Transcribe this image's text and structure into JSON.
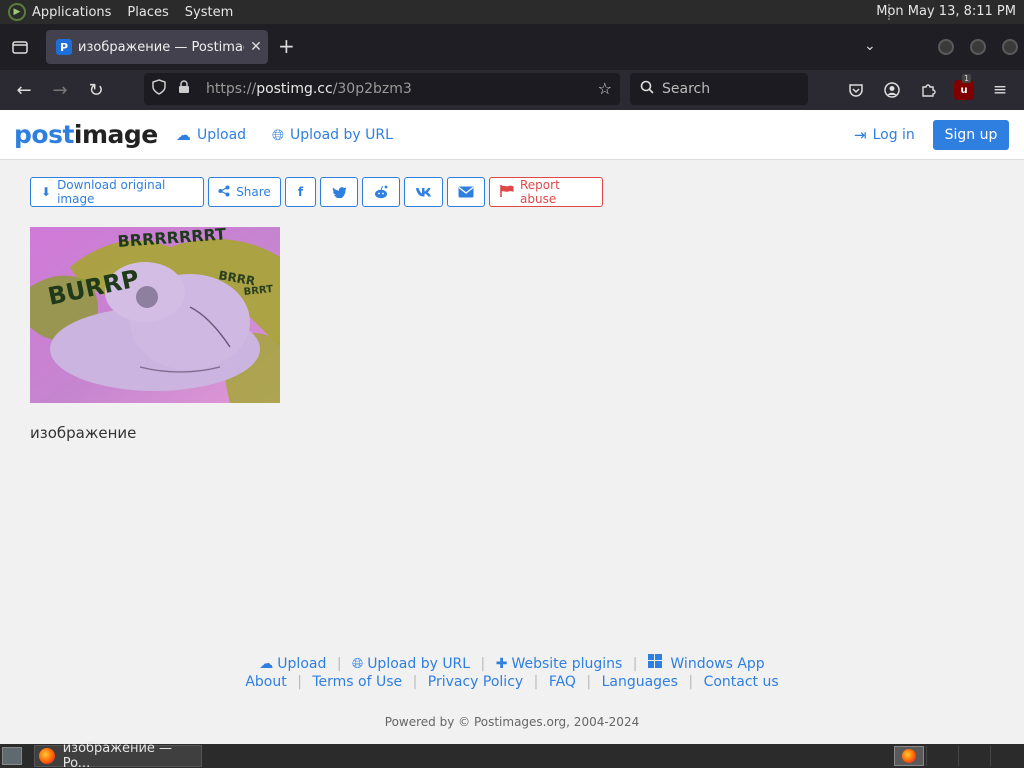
{
  "system_panel": {
    "menus": [
      "Applications",
      "Places",
      "System"
    ],
    "clock": "Mon May 13,  8:11 PM"
  },
  "browser": {
    "tab": {
      "favicon": "P",
      "title": "изображение — Postimage"
    },
    "url": {
      "scheme": "https://",
      "host": "postimg.cc",
      "path": "/30p2bzm3"
    },
    "search_placeholder": "Search",
    "ublock_count": "1"
  },
  "site": {
    "brand_part1": "post",
    "brand_part2": "image",
    "nav": {
      "upload": "Upload",
      "upload_by_url": "Upload by URL",
      "login": "Log in",
      "signup": "Sign up"
    },
    "actions": {
      "download": "Download original image",
      "share": "Share",
      "facebook": "f",
      "twitter": "t",
      "reddit": "r",
      "vk": "vk",
      "email": "mail",
      "report": "Report abuse"
    },
    "image": {
      "caption": "изображение",
      "lettering": [
        "BRRRRRRRT",
        "BURRP",
        "BRRR",
        "BRRT"
      ]
    },
    "footer": {
      "row1": [
        "Upload",
        "Upload by URL",
        "Website plugins",
        "Windows App"
      ],
      "row2": [
        "About",
        "Terms of Use",
        "Privacy Policy",
        "FAQ",
        "Languages",
        "Contact us"
      ],
      "powered": "Powered by © Postimages.org, 2004-2024"
    }
  },
  "taskbar": {
    "window_title": "изображение — Po..."
  },
  "colors": {
    "accent": "#2f7fe0",
    "danger": "#e04848",
    "panel": "#2b2b2b"
  }
}
